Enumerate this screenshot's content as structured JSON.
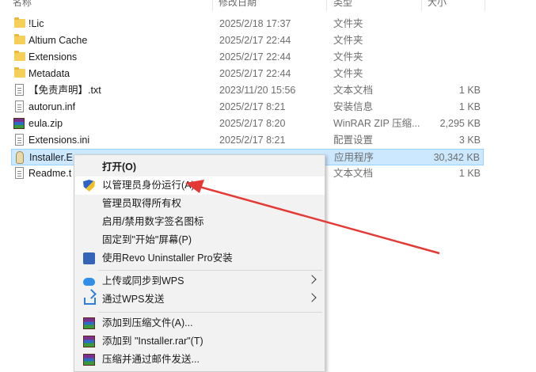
{
  "header": {
    "name_col": "名称",
    "date_col": "修改日期",
    "type_col": "类型",
    "size_col": "大小"
  },
  "files": [
    {
      "name": "!Lic",
      "date": "2025/2/18 17:37",
      "type": "文件夹",
      "size": "",
      "icon": "folder-icon"
    },
    {
      "name": "Altium Cache",
      "date": "2025/2/17 22:44",
      "type": "文件夹",
      "size": "",
      "icon": "folder-icon"
    },
    {
      "name": "Extensions",
      "date": "2025/2/17 22:44",
      "type": "文件夹",
      "size": "",
      "icon": "folder-icon"
    },
    {
      "name": "Metadata",
      "date": "2025/2/17 22:44",
      "type": "文件夹",
      "size": "",
      "icon": "folder-icon"
    },
    {
      "name": "【免责声明】.txt",
      "date": "2023/11/20 15:56",
      "type": "文本文档",
      "size": "1 KB",
      "icon": "text-file-icon"
    },
    {
      "name": "autorun.inf",
      "date": "2025/2/17 8:21",
      "type": "安装信息",
      "size": "1 KB",
      "icon": "setup-info-icon"
    },
    {
      "name": "eula.zip",
      "date": "2025/2/17 8:20",
      "type": "WinRAR ZIP 压缩...",
      "size": "2,295 KB",
      "icon": "winrar-icon"
    },
    {
      "name": "Extensions.ini",
      "date": "2025/2/17 8:21",
      "type": "配置设置",
      "size": "3 KB",
      "icon": "config-file-icon"
    },
    {
      "name": "Installer.E",
      "date": "",
      "type": "应用程序",
      "size": "30,342 KB",
      "icon": "installer-icon",
      "selected": true
    },
    {
      "name": "Readme.t",
      "date": "",
      "type": "文本文档",
      "size": "1 KB",
      "icon": "text-file-icon"
    }
  ],
  "context_menu": {
    "items": [
      {
        "label": "打开(O)",
        "icon": "",
        "bold": true
      },
      {
        "label": "以管理员身份运行(A)",
        "icon": "uac-shield-icon",
        "highlighted": true
      },
      {
        "label": "管理员取得所有权",
        "icon": ""
      },
      {
        "label": "启用/禁用数字签名图标",
        "icon": ""
      },
      {
        "label": "固定到\"开始\"屏幕(P)",
        "icon": ""
      },
      {
        "label": "使用Revo Uninstaller Pro安装",
        "icon": "revo-icon"
      },
      {
        "label": "上传或同步到WPS",
        "icon": "cloud-icon",
        "submenu": true
      },
      {
        "label": "通过WPS发送",
        "icon": "share-icon",
        "submenu": true
      },
      {
        "label": "添加到压缩文件(A)...",
        "icon": "winrar-icon"
      },
      {
        "label": "添加到 \"Installer.rar\"(T)",
        "icon": "winrar-icon"
      },
      {
        "label": "压缩并通过邮件发送...",
        "icon": "winrar-icon"
      }
    ]
  },
  "colors": {
    "selection": "#cce8ff",
    "annotation_arrow": "#e53935",
    "menu_bg": "#f2f2f2"
  }
}
